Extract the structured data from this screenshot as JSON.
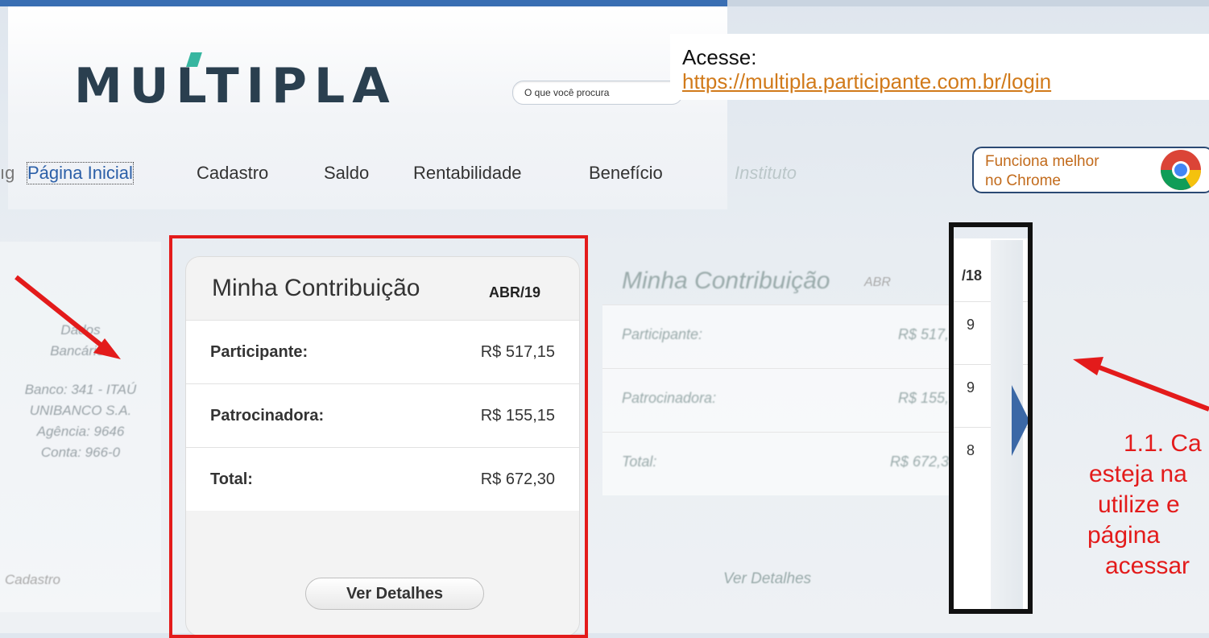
{
  "header": {
    "logo_text": "MULTIPLA",
    "search_placeholder": "O que você procura"
  },
  "nav": {
    "items": [
      {
        "label": "Página Inicial",
        "active": true
      },
      {
        "label": "Cadastro"
      },
      {
        "label": "Saldo"
      },
      {
        "label": "Rentabilidade"
      },
      {
        "label": "Benefício"
      },
      {
        "label": "Instituto"
      }
    ]
  },
  "callout": {
    "prefix": "Acesse:",
    "url": "https://multipla.participante.com.br/login"
  },
  "chrome_note": {
    "line1": "Funciona melhor",
    "line2": "no Chrome",
    "icon": "chrome-icon"
  },
  "left_card": {
    "title_line1": "Dados",
    "title_line2": "Bancários",
    "lines": [
      "Banco: 341 - ITAÚ",
      "UNIBANCO S.A.",
      "Agência: 9646",
      "Conta: 966-0"
    ],
    "link": "Cadastro"
  },
  "main_card": {
    "title": "Minha Contribuição",
    "month": "ABR/19",
    "rows": [
      {
        "label": "Participante:",
        "value": "R$ 517,15"
      },
      {
        "label": "Patrocinadora:",
        "value": "R$ 155,15"
      },
      {
        "label": "Total:",
        "value": "R$ 672,30"
      }
    ],
    "button_label": "Ver Detalhes"
  },
  "ghost_card": {
    "title": "Minha Contribuição",
    "month": "ABR",
    "rows": [
      {
        "label": "Participante:",
        "value": "R$ 517,"
      },
      {
        "label": "Patrocinadora:",
        "value": "R$ 155,"
      },
      {
        "label": "Total:",
        "value": "R$ 672,3"
      }
    ],
    "button_label": "Ver Detalhes"
  },
  "peek_card": {
    "month": "/18",
    "values": [
      "9",
      "9",
      "8"
    ]
  },
  "instructions": {
    "lines": [
      "1.1. Ca",
      "esteja na",
      "utilize e",
      "página",
      "acessar"
    ]
  },
  "colors": {
    "accent_red": "#e31b1b",
    "link_orange": "#d17a1a",
    "nav_blue": "#3b68a6"
  }
}
